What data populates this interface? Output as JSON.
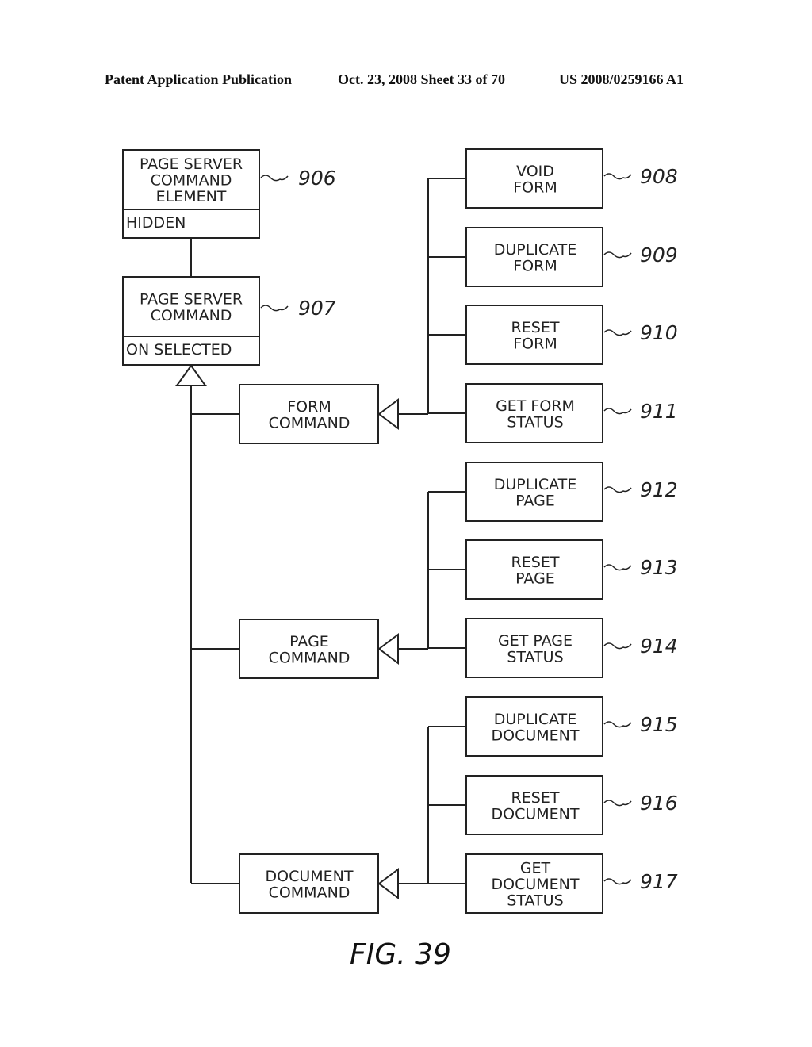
{
  "header": {
    "left": "Patent Application Publication",
    "date_sheet": "Oct. 23, 2008   Sheet 33 of 70",
    "number": "US 2008/0259166 A1"
  },
  "figure_label": "FIG. 39",
  "classes": {
    "element": {
      "ref": "906",
      "lines": [
        "PAGE SERVER",
        "COMMAND",
        "ELEMENT"
      ],
      "attribute": "HIDDEN"
    },
    "command": {
      "ref": "907",
      "lines": [
        "PAGE SERVER",
        "COMMAND"
      ],
      "attribute": "ON SELECTED"
    },
    "form_command": {
      "lines": [
        "FORM",
        "COMMAND"
      ]
    },
    "page_command": {
      "lines": [
        "PAGE",
        "COMMAND"
      ]
    },
    "document_command": {
      "lines": [
        "DOCUMENT",
        "COMMAND"
      ]
    }
  },
  "subclasses": [
    {
      "ref": "908",
      "lines": [
        "VOID",
        "FORM"
      ],
      "parent": "form_command"
    },
    {
      "ref": "909",
      "lines": [
        "DUPLICATE",
        "FORM"
      ],
      "parent": "form_command"
    },
    {
      "ref": "910",
      "lines": [
        "RESET",
        "FORM"
      ],
      "parent": "form_command"
    },
    {
      "ref": "911",
      "lines": [
        "GET FORM",
        "STATUS"
      ],
      "parent": "form_command"
    },
    {
      "ref": "912",
      "lines": [
        "DUPLICATE",
        "PAGE"
      ],
      "parent": "page_command"
    },
    {
      "ref": "913",
      "lines": [
        "RESET",
        "PAGE"
      ],
      "parent": "page_command"
    },
    {
      "ref": "914",
      "lines": [
        "GET PAGE",
        "STATUS"
      ],
      "parent": "page_command"
    },
    {
      "ref": "915",
      "lines": [
        "DUPLICATE",
        "DOCUMENT"
      ],
      "parent": "document_command"
    },
    {
      "ref": "916",
      "lines": [
        "RESET",
        "DOCUMENT"
      ],
      "parent": "document_command"
    },
    {
      "ref": "917",
      "lines": [
        "GET",
        "DOCUMENT",
        "STATUS"
      ],
      "parent": "document_command"
    }
  ]
}
